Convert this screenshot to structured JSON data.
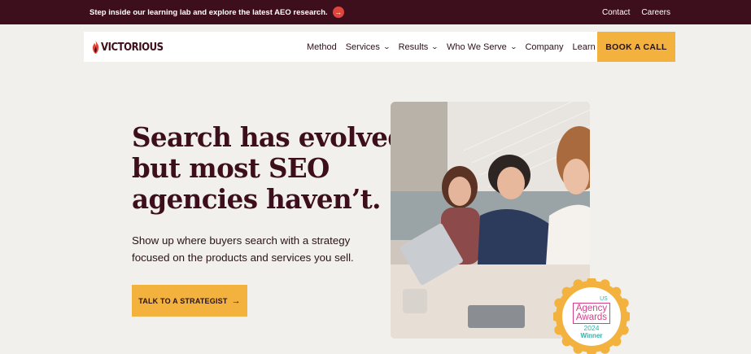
{
  "topbar": {
    "announcement": "Step inside our learning lab and explore the latest AEO research.",
    "links": [
      "Contact",
      "Careers"
    ]
  },
  "header": {
    "logo_text": "VICTORIOUS",
    "nav": [
      {
        "label": "Method",
        "dropdown": false
      },
      {
        "label": "Services",
        "dropdown": true
      },
      {
        "label": "Results",
        "dropdown": true
      },
      {
        "label": "Who We Serve",
        "dropdown": true
      },
      {
        "label": "Company",
        "dropdown": false
      },
      {
        "label": "Learn",
        "dropdown": false
      }
    ],
    "cta_label": "BOOK A CALL"
  },
  "hero": {
    "title_lines": [
      "Search has evolved,",
      "but most SEO",
      "agencies haven’t."
    ],
    "subtitle_lines": [
      "Show up where buyers search with a strategy",
      "focused on the products and services you sell."
    ],
    "cta_label": "TALK TO A STRATEGIST",
    "cta_icon": "arrow-right-icon"
  },
  "badge": {
    "country": "US",
    "title_lines": [
      "Agency",
      "Awards"
    ],
    "year": "2024",
    "status": "Winner"
  },
  "colors": {
    "topbar_bg": "#3d0f1c",
    "accent_yellow": "#f2b23d",
    "page_bg": "#f1f0ec",
    "heading_text": "#3d0f1c",
    "announce_arrow": "#e0453b"
  }
}
